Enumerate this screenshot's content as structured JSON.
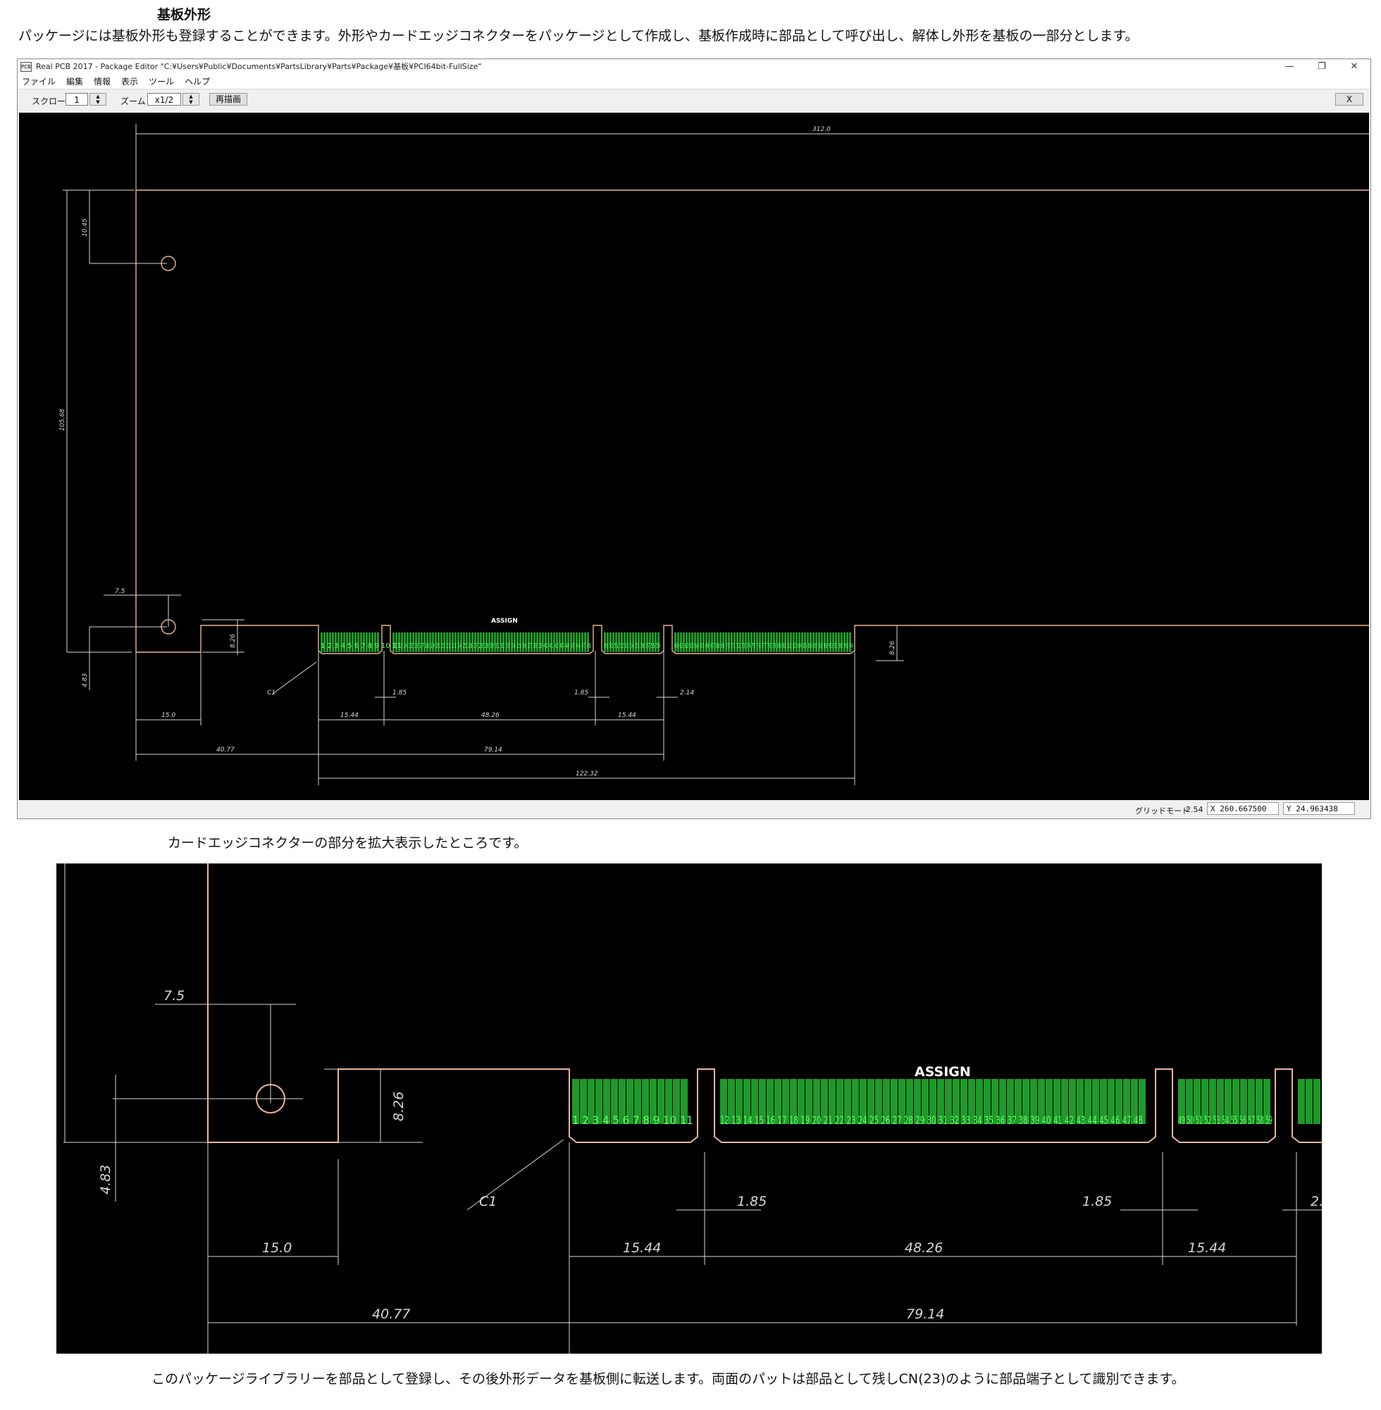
{
  "page": {
    "title": "基板外形",
    "intro": "パッケージには基板外形も登録することができます。外形やカードエッジコネクターをパッケージとして作成し、基板作成時に部品として呼び出し、解体し外形を基板の一部分とします。",
    "caption_zoom": "カードエッジコネクターの部分を拡大表示したところです。",
    "caption_bottom": "このパッケージライブラリーを部品として登録し、その後外形データを基板側に転送します。両面のパットは部品として残しCN(23)のように部品端子として識別できます。"
  },
  "window": {
    "icon_text": "PCB",
    "title": "Real PCB 2017 - Package Editor \"C:¥Users¥Public¥Documents¥PartsLibrary¥Parts¥Package¥基板¥PCI64bit-FullSize\"",
    "controls": {
      "minimize": "—",
      "restore": "❐",
      "close": "✕"
    }
  },
  "menu": [
    "ファイル",
    "編集",
    "情報",
    "表示",
    "ツール",
    "ヘルプ"
  ],
  "toolbar": {
    "scroll_label": "スクロール",
    "scroll_value": "1",
    "zoom_label": "ズーム",
    "zoom_value": "x1/2",
    "redraw_label": "再描画",
    "close_label": "X"
  },
  "drawing": {
    "assign_label": "ASSIGN",
    "dimensions": {
      "overall_width": "312.0",
      "hole_offset": "10.45",
      "height": "105.68",
      "hole_x": "7.5",
      "hole_y": "4.83",
      "tab_height": "8.26",
      "chamfer": "C1",
      "key_width_a": "1.85",
      "key_width_b": "1.85",
      "key_width_c": "2.14",
      "tab_offset": "15.0",
      "seg_a": "15.44",
      "seg_b": "48.26",
      "seg_c": "15.44",
      "edge_offset": "40.77",
      "span_a": "79.14",
      "span_total": "122.32"
    },
    "pad_labels": {
      "group1": "1 2 3 4 5 6 7 8 9 10 11",
      "group2": "12 13 14 15 16 17 18 19 20 21 22 23 24 25 26 27 28 29 30 31 32 33 34 35 36 37 38 39 40 41 42 43 44 45 46 47 48",
      "group3": "49 50 51 52 53 54 55 56 57 58 59",
      "group4": "60 61 62 63 64 65 66 67 68 69 70 71 72 73 74 75 76 77 78 79 80 81 82 83 84 85 86 87 88 89 90 91 92 93 94"
    },
    "colors": {
      "background": "#000000",
      "outline": "#e8b898",
      "dimension": "#d8d8d8",
      "pad_fill": "#1f9a2a",
      "pad_text": "#5cff6a"
    }
  },
  "status": {
    "grid_label": "グリッドモード",
    "grid_value": "2.54",
    "x_value": "X 260.667500",
    "y_value": "Y 24.963438"
  }
}
